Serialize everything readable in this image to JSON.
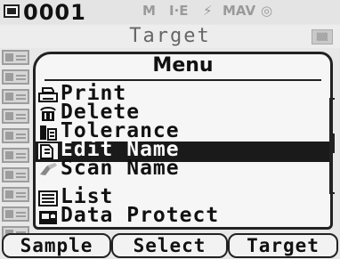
{
  "status": {
    "record_number": "0001",
    "indicators": [
      "M",
      "I·E",
      "⚡",
      "MAV",
      "◎"
    ]
  },
  "header": {
    "title": "Target",
    "badge": "▒▒"
  },
  "menu": {
    "title": "Menu",
    "items": [
      {
        "label": "Print",
        "icon": "printer-icon",
        "selected": false
      },
      {
        "label": "Delete",
        "icon": "trash-icon",
        "selected": false
      },
      {
        "label": "Tolerance",
        "icon": "tolerance-icon",
        "selected": false
      },
      {
        "label": "Edit Name",
        "icon": "edit-name-icon",
        "selected": true
      },
      {
        "label": "Scan Name",
        "icon": "scan-icon",
        "selected": false
      },
      {
        "label": "List",
        "icon": "list-icon",
        "selected": false
      },
      {
        "label": "Data Protect",
        "icon": "protect-icon",
        "selected": false
      }
    ]
  },
  "softkeys": [
    "Sample",
    "Select",
    "Target"
  ]
}
